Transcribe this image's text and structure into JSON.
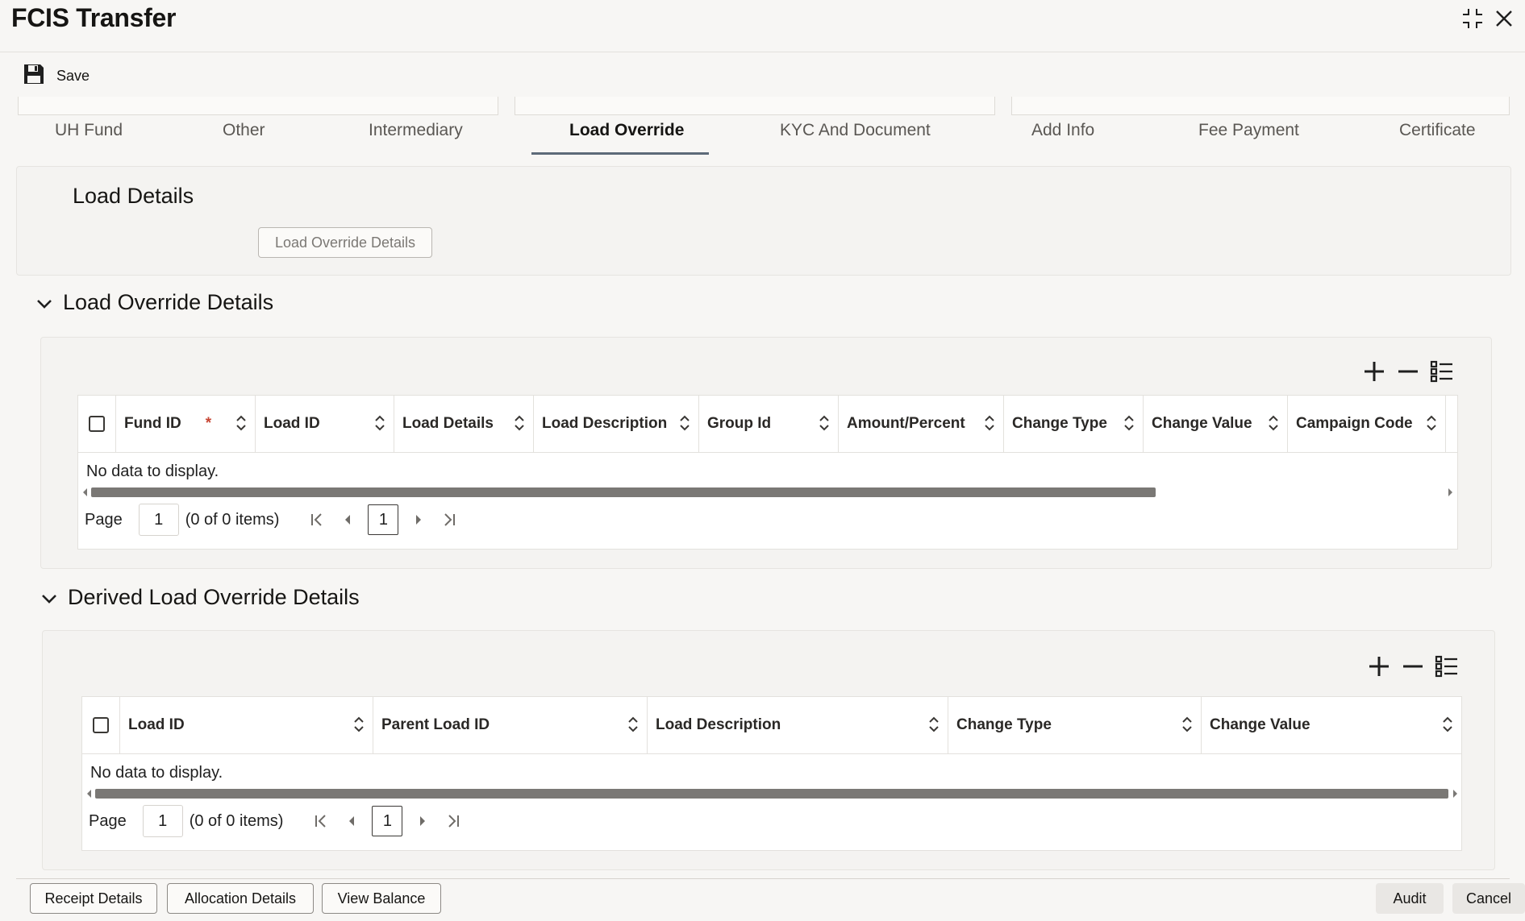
{
  "window": {
    "title": "FCIS Transfer"
  },
  "toolbar": {
    "save_label": "Save"
  },
  "tabs": [
    {
      "label": "UH Fund"
    },
    {
      "label": "Other"
    },
    {
      "label": "Intermediary"
    },
    {
      "label": "Load Override",
      "active": true
    },
    {
      "label": "KYC And Document"
    },
    {
      "label": "Add Info"
    },
    {
      "label": "Fee Payment"
    },
    {
      "label": "Certificate"
    }
  ],
  "load_details": {
    "heading": "Load Details",
    "button_label": "Load Override Details"
  },
  "load_override_section": {
    "heading": "Load Override Details",
    "columns": [
      {
        "label": "Fund ID",
        "required_mark": "*"
      },
      {
        "label": "Load ID"
      },
      {
        "label": "Load Details"
      },
      {
        "label": "Load Description"
      },
      {
        "label": "Group Id"
      },
      {
        "label": "Amount/Percent"
      },
      {
        "label": "Change Type"
      },
      {
        "label": "Change Value"
      },
      {
        "label": "Campaign Code"
      }
    ],
    "empty_text": "No data to display.",
    "pager": {
      "page_label": "Page",
      "page_value": "1",
      "items_text": "(0 of 0 items)",
      "current_page": "1"
    }
  },
  "derived_section": {
    "heading": "Derived Load Override Details",
    "columns": [
      {
        "label": "Load ID"
      },
      {
        "label": "Parent Load ID"
      },
      {
        "label": "Load Description"
      },
      {
        "label": "Change Type"
      },
      {
        "label": "Change Value"
      }
    ],
    "empty_text": "No data to display.",
    "pager": {
      "page_label": "Page",
      "page_value": "1",
      "items_text": "(0 of 0 items)",
      "current_page": "1"
    }
  },
  "footer": {
    "receipt_details": "Receipt Details",
    "allocation_details": "Allocation Details",
    "view_balance": "View Balance",
    "audit": "Audit",
    "cancel": "Cancel"
  },
  "colors": {
    "accent_underline": "#5d6a78",
    "required": "#c74634",
    "scrollbar": "#7a7875"
  }
}
